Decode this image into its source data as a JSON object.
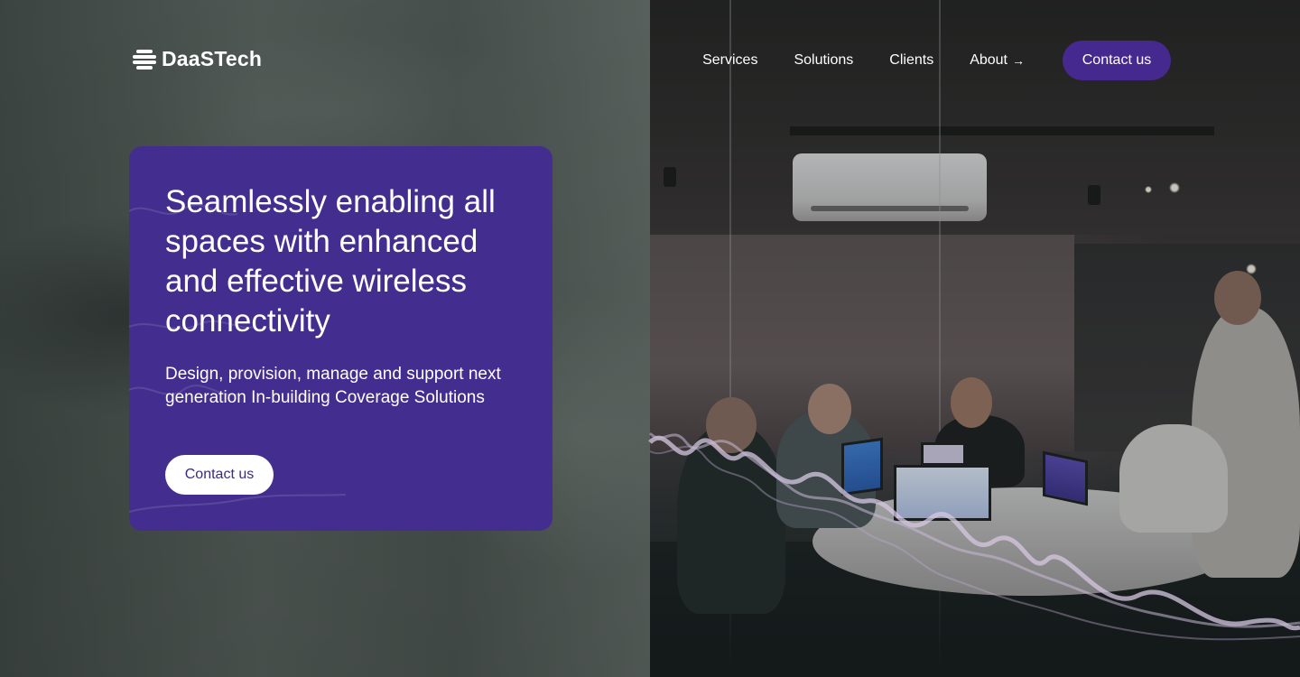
{
  "brand": {
    "name": "DaaSTech",
    "accent_color": "#46298f",
    "card_color": "#432e8f"
  },
  "nav": {
    "items": [
      {
        "label": "Services"
      },
      {
        "label": "Solutions"
      },
      {
        "label": "Clients"
      },
      {
        "label": "About"
      }
    ],
    "about_arrow": "→",
    "contact_label": "Contact us"
  },
  "hero": {
    "title": "Seamlessly enabling all spaces with enhanced and effective wireless connectivity",
    "subtitle": "Design, provision, manage and support next generation In-building Coverage Solutions",
    "cta_label": "Contact us"
  },
  "icons": {
    "logo": "stacked-lines-logo-icon",
    "about": "arrow-right-icon"
  }
}
